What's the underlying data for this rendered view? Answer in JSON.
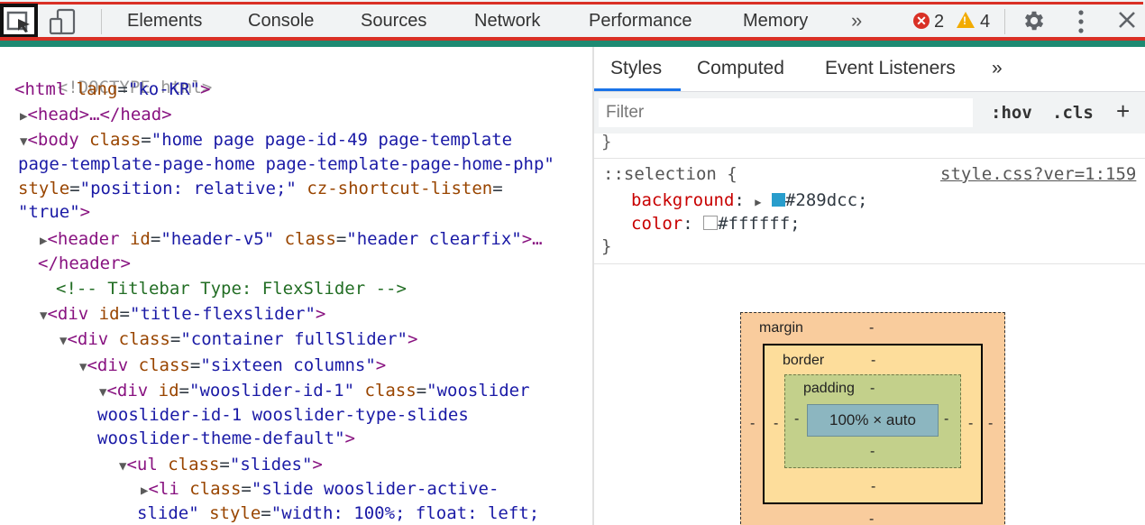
{
  "toolbar": {
    "tabs": [
      "Elements",
      "Console",
      "Sources",
      "Network",
      "Performance",
      "Memory"
    ],
    "more_tabs": "»",
    "errors": "2",
    "warnings": "4",
    "close": "✕"
  },
  "dom": {
    "doctype": "<!DOCTYPE html>",
    "html_tag": "<html",
    "html_lang_attr": "lang",
    "html_lang_val": "\"ko-KR\"",
    "head": "<head>…</head>",
    "body_open": "<body",
    "body_class_attr": "class",
    "body_class_1": "\"home page page-id-49 page-template",
    "body_class_2": "page-template-page-home page-template-page-home-php\"",
    "body_style_attr": "style",
    "body_style_val": "\"position: relative;\"",
    "body_cz_attr": "cz-shortcut-listen",
    "body_cz_val": "\"true\"",
    "header_tag": "<header",
    "header_id_attr": "id",
    "header_id_val": "\"header-v5\"",
    "header_class_attr": "class",
    "header_class_val": "\"header clearfix\"",
    "header_rest": ">…",
    "header_close": "</header>",
    "comment": "<!-- Titlebar Type: FlexSlider -->",
    "div1_tag": "<div",
    "div1_id_attr": "id",
    "div1_id_val": "\"title-flexslider\"",
    "div2_tag": "<div",
    "div2_class_attr": "class",
    "div2_class_val": "\"container fullSlider\"",
    "div3_tag": "<div",
    "div3_class_attr": "class",
    "div3_class_val": "\"sixteen columns\"",
    "div4_tag": "<div",
    "div4_id_attr": "id",
    "div4_id_val": "\"wooslider-id-1\"",
    "div4_class_attr": "class",
    "div4_class_1": "\"wooslider",
    "div4_class_2": "wooslider-id-1 wooslider-type-slides",
    "div4_class_3": "wooslider-theme-default\"",
    "ul_tag": "<ul",
    "ul_class_attr": "class",
    "ul_class_val": "\"slides\"",
    "li_tag": "<li",
    "li_class_attr": "class",
    "li_class_1": "\"slide wooslider-active-",
    "li_class_2": "slide\"",
    "li_style_attr": "style",
    "li_style_val": "\"width: 100%; float: left;"
  },
  "styles_pane": {
    "tabs": [
      "Styles",
      "Computed",
      "Event Listeners"
    ],
    "more_tabs": "»",
    "filter_placeholder": "Filter",
    "hov": ":hov",
    "cls": ".cls",
    "plus": "+",
    "prev_rule_close": "}",
    "selector": "::selection {",
    "source_link": "style.css?ver=1:159",
    "props": [
      {
        "name": "background",
        "value": "#289dcc;",
        "swatch": "#289dcc"
      },
      {
        "name": "color",
        "value": "#ffffff;",
        "swatch": "#ffffff"
      }
    ],
    "rule_close": "}"
  },
  "box_model": {
    "margin_label": "margin",
    "border_label": "border",
    "padding_label": "padding",
    "content": "100% × auto",
    "dash": "-"
  },
  "colors": {
    "tag": "#881280",
    "attr_name": "#994500",
    "attr_value": "#1a1aa6",
    "comment": "#236e25",
    "accent": "#1a73e8"
  }
}
